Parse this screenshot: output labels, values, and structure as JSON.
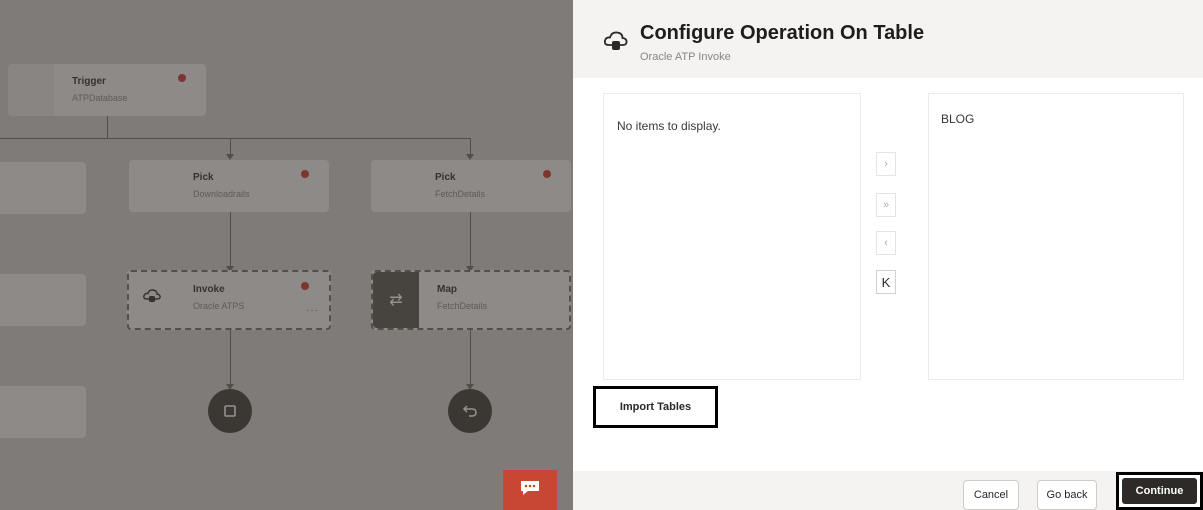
{
  "canvas": {
    "trigger_node": {
      "title": "Trigger",
      "subtitle": "ATPDatabase"
    },
    "pick_node_1": {
      "title": "Pick",
      "subtitle": "Downloadrails"
    },
    "pick_node_2": {
      "title": "Pick",
      "subtitle": "FetchDetails"
    },
    "invoke_node": {
      "title": "Invoke",
      "subtitle": "Oracle ATPS",
      "more": "···"
    },
    "map_node": {
      "title": "Map",
      "subtitle": "FetchDetails"
    }
  },
  "panel": {
    "title": "Configure Operation On Table",
    "subtitle": "Oracle ATP Invoke",
    "available_list": {
      "empty_text": "No items to display."
    },
    "selected_list": {
      "items": [
        "BLOG"
      ]
    },
    "shuttle_buttons": {
      "move": "›",
      "move_all": "»",
      "remove": "‹",
      "remove_all": "K"
    },
    "import_button": "Import Tables",
    "footer": {
      "cancel": "Cancel",
      "back": "Go back",
      "continue": "Continue"
    }
  },
  "colors": {
    "accent_red": "#c74634",
    "error_dot": "#c7332b",
    "primary_dark": "#2e2a27"
  }
}
